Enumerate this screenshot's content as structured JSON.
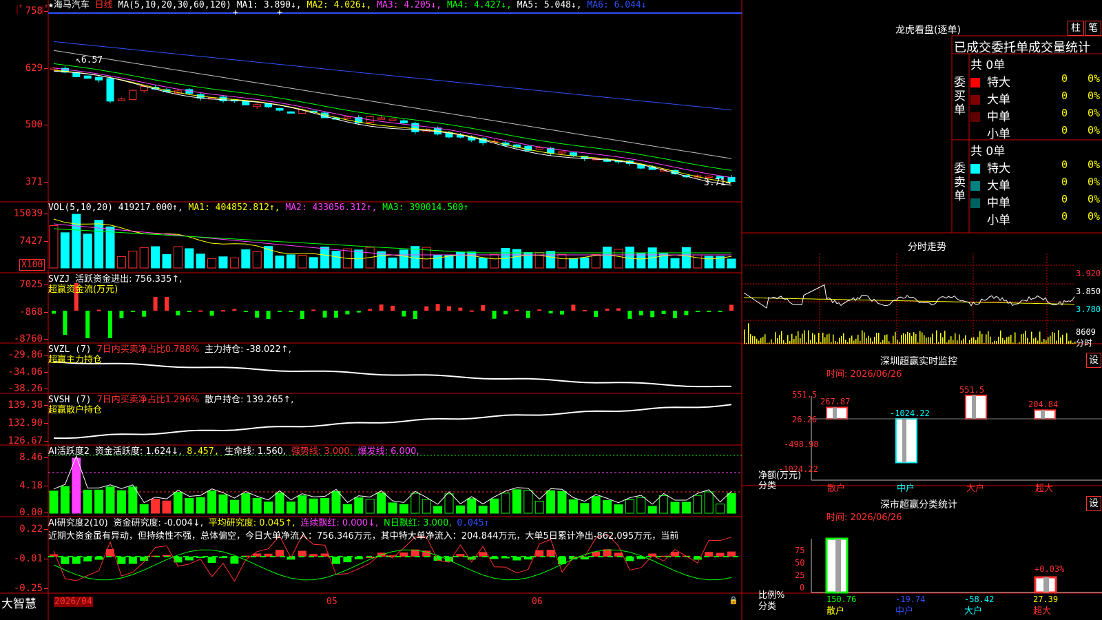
{
  "main_header": {
    "prefix": "★",
    "stock_name": "海马汽车",
    "period": "日线",
    "ma_label": "MA(5,10,20,30,60,120)",
    "ma1": "MA1: 3.890↓,",
    "ma2": "MA2: 4.026↓,",
    "ma3": "MA3: 4.205↓,",
    "ma4": "MA4: 4.427↓,",
    "ma5": "MA5: 5.048↓,",
    "ma6": "MA6: 6.044↓"
  },
  "price_axis": {
    "t1": "758",
    "t2": "629",
    "t3": "500",
    "t4": "371"
  },
  "price_annotations": {
    "high": "6.57",
    "low": "3.71"
  },
  "vol_header": {
    "label": "VOL(5,10,20)",
    "value": "419217.000↑,",
    "ma1": "MA1: 404852.812↑,",
    "ma2": "MA2: 433056.312↑,",
    "ma3": "MA3: 390014.500↑"
  },
  "vol_axis": {
    "t1": "15039",
    "t2": "7427",
    "unit": "X100"
  },
  "svzj": {
    "label": "SVZJ",
    "text": "活跃资金进出: 756.335↑,",
    "sub": "超赢资金流(万元)",
    "t1": "7025",
    "t2": "-868",
    "t3": "-8760"
  },
  "svzl": {
    "label": "SVZL (7)",
    "ratio": "7日内买卖净占比0.788%",
    "text": "主力持仓: -38.022↑,",
    "sub": "超赢主力持仓",
    "t1": "-29.86",
    "t2": "-34.06",
    "t3": "-38.26"
  },
  "svsh": {
    "label": "SVSH (7)",
    "ratio": "7日内买卖净占比1.296%",
    "text": "散户持仓: 139.265↑,",
    "sub": "超赢散户持仓",
    "t1": "139.38",
    "t2": "132.90",
    "t3": "126.67"
  },
  "ai_active": {
    "label": "AI活跃度2",
    "a": "资金活跃度: 1.624↓,",
    "b": "8.457,",
    "c": "生命线: 1.560,",
    "d": "强势线: 3.000,",
    "e": "爆发线: 6.000,",
    "t1": "8.46",
    "t2": "4.18",
    "t3": "0.00"
  },
  "ai_research": {
    "label": "AI研究度2(10)",
    "a": "资金研究度: -0.004↓,",
    "b": "平均研究度: 0.045↑,",
    "c": "连续飘红: 0.000↓,",
    "d": "N日飘红: 3.000,",
    "e": "0.045↑",
    "comment": "近期大资金虽有异动，但持续性不强，总体偏空，今日大单净流入：756.346万元，其中特大单净流入：204.844万元，大单5日累计净出-862.095万元，当前",
    "t1": "0.22",
    "t2": "-0.01",
    "t3": "-0.25"
  },
  "bottom_axis": {
    "brand": "大智慧",
    "d1": "2026/04",
    "d2": "05",
    "d3": "06"
  },
  "right_panel": {
    "longhu_title": "龙虎看盘(逐单)",
    "btn_bar": "柱",
    "btn_pen": "笔",
    "stats_title": "已成交委托单成交量统计",
    "buy_total": "共 0单",
    "buy_side_label": "委买单",
    "buy_rows": [
      {
        "name": "特大",
        "count": "0",
        "pct": "0%",
        "color": "#ff0000"
      },
      {
        "name": "大单",
        "count": "0",
        "pct": "0%",
        "color": "#800000"
      },
      {
        "name": "中单",
        "count": "0",
        "pct": "0%",
        "color": "#600000"
      },
      {
        "name": "小单",
        "count": "0",
        "pct": "0%",
        "color": "#000000"
      }
    ],
    "sell_total": "共 0单",
    "sell_side_label": "委卖单",
    "sell_rows": [
      {
        "name": "特大",
        "count": "0",
        "pct": "0%",
        "color": "#00ffff"
      },
      {
        "name": "大单",
        "count": "0",
        "pct": "0%",
        "color": "#008080"
      },
      {
        "name": "中单",
        "count": "0",
        "pct": "0%",
        "color": "#006060"
      },
      {
        "name": "小单",
        "count": "0",
        "pct": "0%",
        "color": "#000000"
      }
    ],
    "intraday_title": "分时走势",
    "intraday_ticks": {
      "p1": "3.920",
      "p2": "3.850",
      "p3": "3.780",
      "vol": "8609"
    },
    "intraday_footer": "分时",
    "monitor_title": "深圳超赢实时监控",
    "monitor_btn": "设",
    "monitor_time": "时间: 2026/06/26",
    "monitor_axis": {
      "t1": "551.5",
      "t2": "26.26",
      "t3": "-498.98",
      "t4": "-1024.22"
    },
    "monitor_bars": [
      {
        "cat": "散户",
        "value": 267.87,
        "label": "267.87"
      },
      {
        "cat": "中户",
        "value": -1024.22,
        "label": "-1024.22"
      },
      {
        "cat": "大户",
        "value": 551.5,
        "label": "551.5"
      },
      {
        "cat": "超大",
        "value": 204.84,
        "label": "204.84"
      }
    ],
    "monitor_ylabel": "净额(万元)",
    "monitor_xlabel": "分类",
    "classify_title": "深市超赢分类统计",
    "classify_btn": "设",
    "classify_time": "时间: 2026/06/26",
    "classify_axis": {
      "t1": "75",
      "t2": "50",
      "t3": "25",
      "t4": "0"
    },
    "classify_pct_label": "+0.03%",
    "classify_ylabel": "比例%",
    "classify_xlabel": "分类",
    "classify_values": [
      {
        "cat": "散户",
        "label": "150.76",
        "color": "#00ff00"
      },
      {
        "cat": "中户",
        "label": "-19.74",
        "color": "#3050ff"
      },
      {
        "cat": "大户",
        "label": "-58.42",
        "color": "#00ffff"
      },
      {
        "cat": "超大",
        "label": "27.39",
        "color": "#ffff00"
      }
    ]
  },
  "colors": {
    "up": "#ff3030",
    "down": "#00ffff",
    "grid": "#cc0000",
    "bg": "#000000"
  }
}
